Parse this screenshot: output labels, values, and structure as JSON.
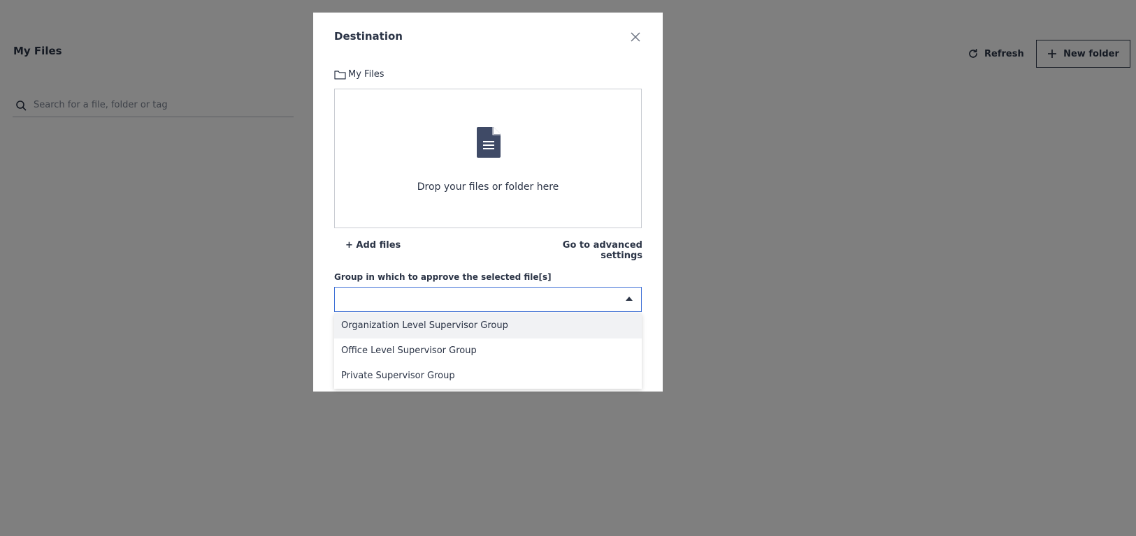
{
  "page": {
    "title": "My Files",
    "search_placeholder": "Search for a file, folder or tag",
    "refresh_label": "Refresh",
    "new_folder_label": "New folder"
  },
  "modal": {
    "title": "Destination",
    "breadcrumb": "My Files",
    "dropzone_text": "Drop your files or folder here",
    "add_files_label": "+ Add files",
    "advanced_label": "Go to advanced settings",
    "group_label": "Group in which to approve the selected file[s]",
    "group_value": "",
    "options": [
      "Organization Level Supervisor Group",
      "Office Level Supervisor Group",
      "Private Supervisor Group"
    ]
  },
  "colors": {
    "text": "#2b3446",
    "focus_border": "#3d6fd6",
    "overlay": "rgba(0,0,0,0.5)"
  }
}
